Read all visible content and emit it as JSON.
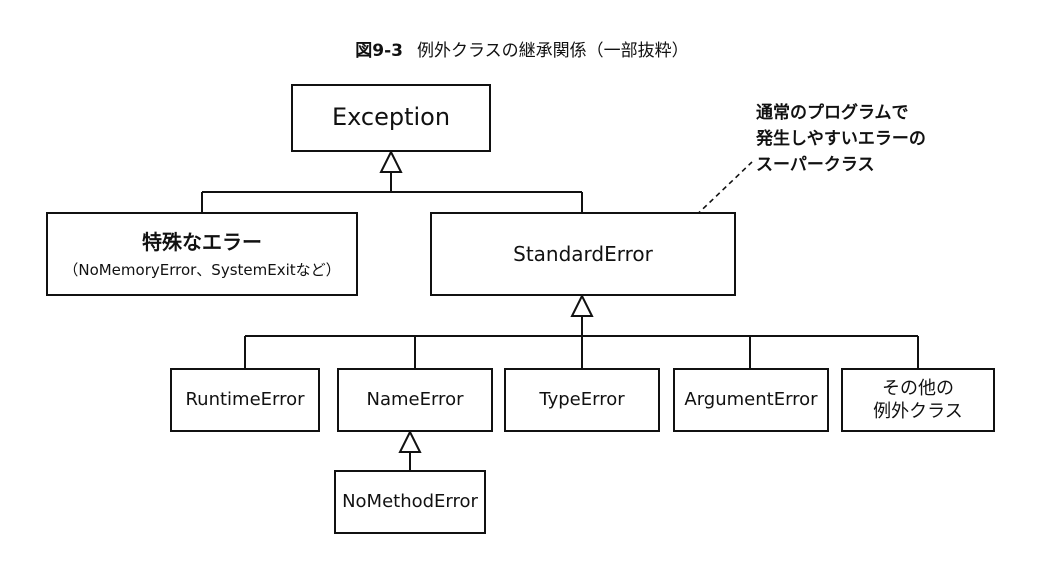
{
  "caption": {
    "number": "図9-3",
    "title": "例外クラスの継承関係（一部抜粋）"
  },
  "nodes": {
    "exception": "Exception",
    "special_error_title": "特殊なエラー",
    "special_error_sub": "（NoMemoryError、SystemExitなど）",
    "standard_error": "StandardError",
    "runtime_error": "RuntimeError",
    "name_error": "NameError",
    "type_error": "TypeError",
    "argument_error": "ArgumentError",
    "other_line1": "その他の",
    "other_line2": "例外クラス",
    "no_method_error": "NoMethodError"
  },
  "note": {
    "line1": "通常のプログラムで",
    "line2": "発生しやすいエラーの",
    "line3": "スーパークラス"
  }
}
